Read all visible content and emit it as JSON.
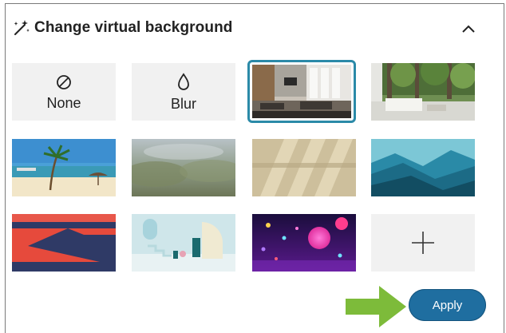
{
  "header": {
    "title": "Change virtual background",
    "wand_icon": "magic-wand-icon",
    "collapse_icon": "chevron-up-icon"
  },
  "options": {
    "none_label": "None",
    "blur_label": "Blur",
    "none_icon": "prohibit-icon",
    "blur_icon": "droplet-icon",
    "add_icon": "plus-icon"
  },
  "backgrounds": [
    {
      "name": "office-room",
      "selected": true
    },
    {
      "name": "living-room-forest",
      "selected": false
    },
    {
      "name": "beach-palm",
      "selected": false
    },
    {
      "name": "blurred-landscape",
      "selected": false
    },
    {
      "name": "window-shadows",
      "selected": false
    },
    {
      "name": "blue-mountains",
      "selected": false
    },
    {
      "name": "red-zigzag",
      "selected": false
    },
    {
      "name": "pastel-architecture",
      "selected": false
    },
    {
      "name": "neon-bokeh",
      "selected": false
    }
  ],
  "apply_label": "Apply",
  "colors": {
    "accent": "#1f6ea0",
    "selection_ring": "#2b8aa8",
    "pointer_arrow": "#7dbb3a"
  }
}
